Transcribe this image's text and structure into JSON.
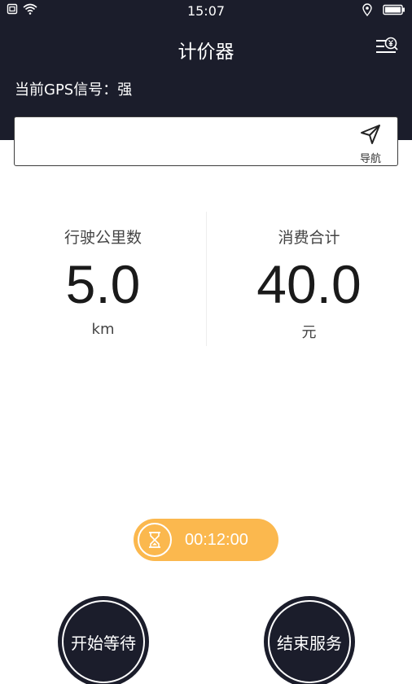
{
  "status_bar": {
    "time": "15:07",
    "icons_left": [
      "sim-icon",
      "wifi-icon"
    ],
    "icons_right": [
      "location-icon",
      "battery-icon"
    ]
  },
  "header": {
    "title": "计价器",
    "menu_icon": "fee-list-icon"
  },
  "gps": {
    "label": "当前GPS信号：",
    "value": "强"
  },
  "search": {
    "value": "",
    "nav_label": "导航",
    "nav_icon": "navigation-arrow-icon"
  },
  "stats": {
    "distance": {
      "label": "行驶公里数",
      "value": "5.0",
      "unit": "km"
    },
    "cost": {
      "label": "消费合计",
      "value": "40.0",
      "unit": "元"
    }
  },
  "timer": {
    "icon": "hourglass-icon",
    "value": "00:12:00",
    "color": "#fbb84e"
  },
  "actions": {
    "start_wait": "开始等待",
    "end_service": "结束服务"
  },
  "colors": {
    "header_bg": "#1b1d2b",
    "accent": "#fbb84e"
  }
}
